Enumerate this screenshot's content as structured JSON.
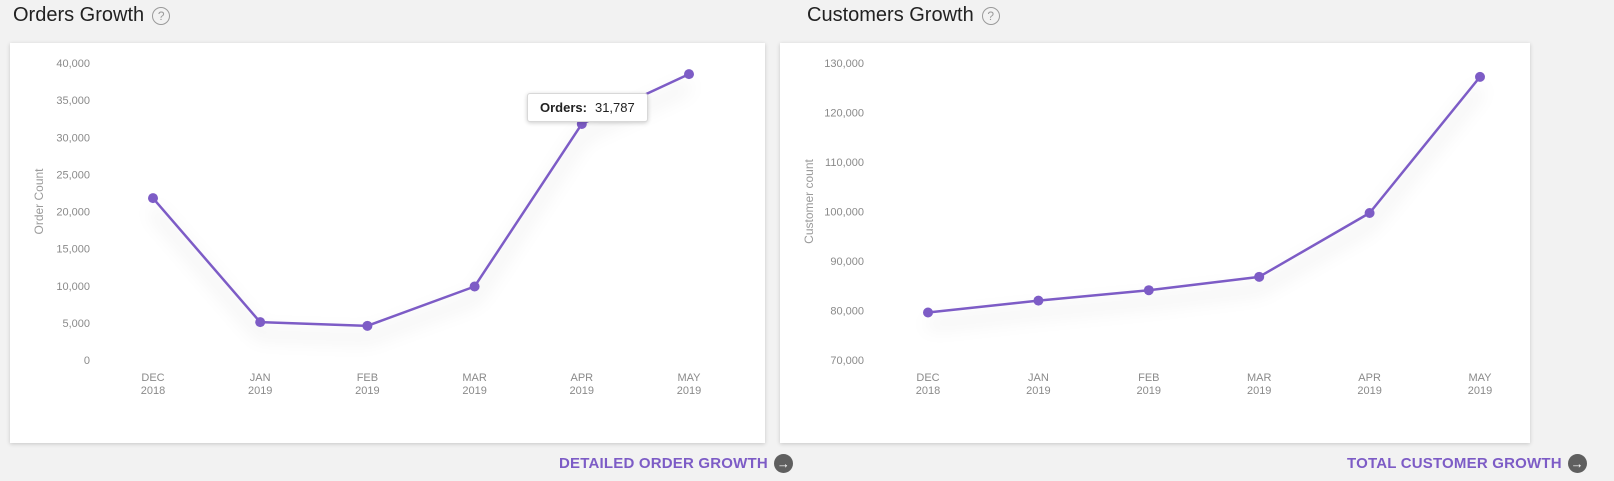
{
  "panels": [
    {
      "title": "Orders Growth",
      "link_label": "DETAILED ORDER GROWTH",
      "tooltip": {
        "label": "Orders:",
        "value": "31,787"
      }
    },
    {
      "title": "Customers Growth",
      "link_label": "TOTAL CUSTOMER GROWTH"
    }
  ],
  "help_icon_glyph": "?",
  "arrow_icon_glyph": "→",
  "accent_color": "#7d5cc6",
  "chart_data": [
    {
      "type": "line",
      "ylabel": "Order Count",
      "categories": [
        [
          "DEC",
          "2018"
        ],
        [
          "JAN",
          "2019"
        ],
        [
          "FEB",
          "2019"
        ],
        [
          "MAR",
          "2019"
        ],
        [
          "APR",
          "2019"
        ],
        [
          "MAY",
          "2019"
        ]
      ],
      "values": [
        21800,
        5100,
        4600,
        9900,
        31787,
        38500
      ],
      "ylim": [
        0,
        40000
      ],
      "yticks": [
        0,
        5000,
        10000,
        15000,
        20000,
        25000,
        30000,
        35000,
        40000
      ],
      "ytick_labels": [
        "0",
        "5,000",
        "10,000",
        "15,000",
        "20,000",
        "25,000",
        "30,000",
        "35,000",
        "40,000"
      ],
      "grid": false,
      "legend": "none"
    },
    {
      "type": "line",
      "ylabel": "Customer count",
      "categories": [
        [
          "DEC",
          "2018"
        ],
        [
          "JAN",
          "2019"
        ],
        [
          "FEB",
          "2019"
        ],
        [
          "MAR",
          "2019"
        ],
        [
          "APR",
          "2019"
        ],
        [
          "MAY",
          "2019"
        ]
      ],
      "values": [
        79600,
        82000,
        84100,
        86800,
        99700,
        127200
      ],
      "ylim": [
        70000,
        130000
      ],
      "yticks": [
        70000,
        80000,
        90000,
        100000,
        110000,
        120000,
        130000
      ],
      "ytick_labels": [
        "70,000",
        "80,000",
        "90,000",
        "100,000",
        "110,000",
        "120,000",
        "130,000"
      ],
      "grid": false,
      "legend": "none"
    }
  ]
}
